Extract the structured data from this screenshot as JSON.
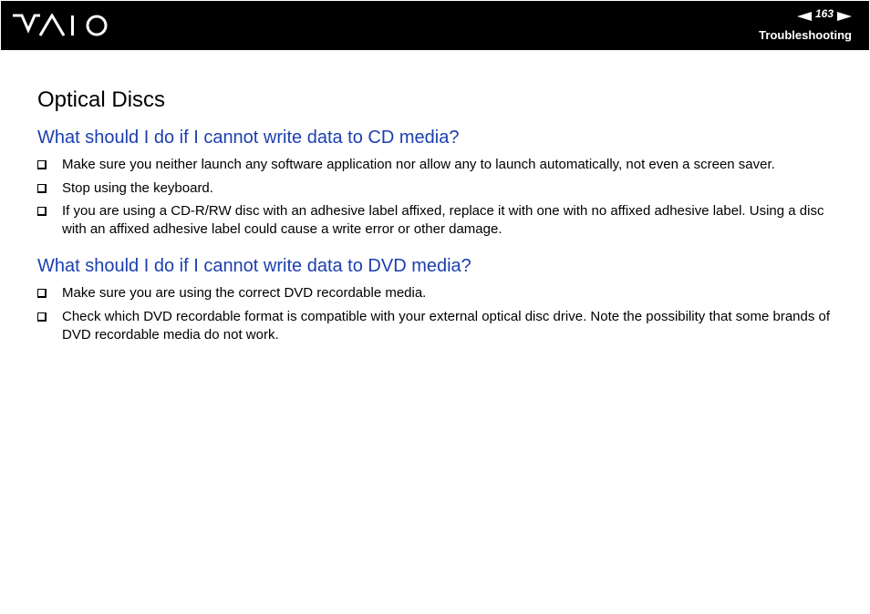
{
  "header": {
    "logo_text": "VAIO",
    "page_number": "163",
    "section": "Troubleshooting",
    "prev_icon": "left-arrow-icon",
    "next_icon": "right-arrow-icon"
  },
  "title": "Optical Discs",
  "sections": [
    {
      "heading": "What should I do if I cannot write data to CD media?",
      "items": [
        "Make sure you neither launch any software application nor allow any to launch automatically, not even a screen saver.",
        "Stop using the keyboard.",
        "If you are using a CD-R/RW disc with an adhesive label affixed, replace it with one with no affixed adhesive label. Using a disc with an affixed adhesive label could cause a write error or other damage."
      ]
    },
    {
      "heading": "What should I do if I cannot write data to DVD media?",
      "items": [
        "Make sure you are using the correct DVD recordable media.",
        "Check which DVD recordable format is compatible with your external optical disc drive. Note the possibility that some brands of DVD recordable media do not work."
      ]
    }
  ],
  "colors": {
    "header_bg": "#000000",
    "heading_blue": "#1b3fb0",
    "body_text": "#000000"
  }
}
